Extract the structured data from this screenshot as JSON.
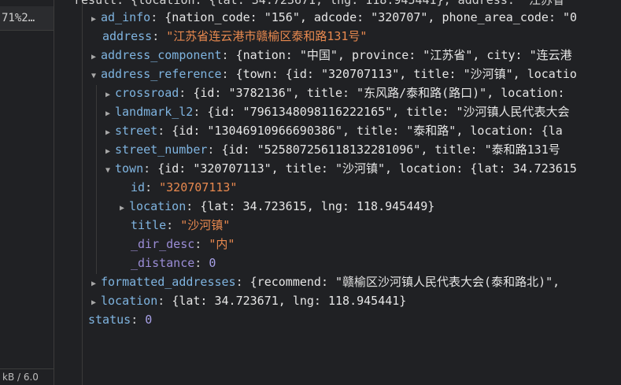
{
  "left_pane": {
    "selected_item": "71%2…",
    "footer": "kB / 6.0"
  },
  "tree": {
    "result_line": "result: {location: {lat: 34.723671, lng: 118.945441}, address: \"江苏省",
    "ad_info": {
      "key": "ad_info",
      "summary": "{nation_code: \"156\", adcode: \"320707\", phone_area_code: \"0"
    },
    "address": {
      "key": "address",
      "value": "\"江苏省连云港市赣榆区泰和路131号\""
    },
    "address_component": {
      "key": "address_component",
      "summary": "{nation: \"中国\", province: \"江苏省\", city: \"连云港"
    },
    "address_reference": {
      "key": "address_reference",
      "summary": "{town: {id: \"320707113\", title: \"沙河镇\", locatio"
    },
    "crossroad": {
      "key": "crossroad",
      "summary": "{id: \"3782136\", title: \"东风路/泰和路(路口)\", location:"
    },
    "landmark_l2": {
      "key": "landmark_l2",
      "summary": "{id: \"7961348098116222165\", title: \"沙河镇人民代表大会"
    },
    "street": {
      "key": "street",
      "summary": "{id: \"13046910966690386\", title: \"泰和路\", location: {la"
    },
    "street_number": {
      "key": "street_number",
      "summary": "{id: \"525807256118132281096\", title: \"泰和路131号"
    },
    "town": {
      "key": "town",
      "summary": "{id: \"320707113\", title: \"沙河镇\", location: {lat: 34.723615"
    },
    "town_id": {
      "key": "id",
      "value": "\"320707113\""
    },
    "town_location": {
      "key": "location",
      "summary": "{lat: 34.723615, lng: 118.945449}"
    },
    "town_title": {
      "key": "title",
      "value": "\"沙河镇\""
    },
    "town_dir_desc": {
      "key": "_dir_desc",
      "value": "\"内\""
    },
    "town_distance": {
      "key": "_distance",
      "value": "0"
    },
    "formatted_addresses": {
      "key": "formatted_addresses",
      "summary": "{recommend: \"赣榆区沙河镇人民代表大会(泰和路北)\","
    },
    "location": {
      "key": "location",
      "summary": "{lat: 34.723671, lng: 118.945441}"
    },
    "status": {
      "key": "status",
      "value": "0"
    }
  }
}
